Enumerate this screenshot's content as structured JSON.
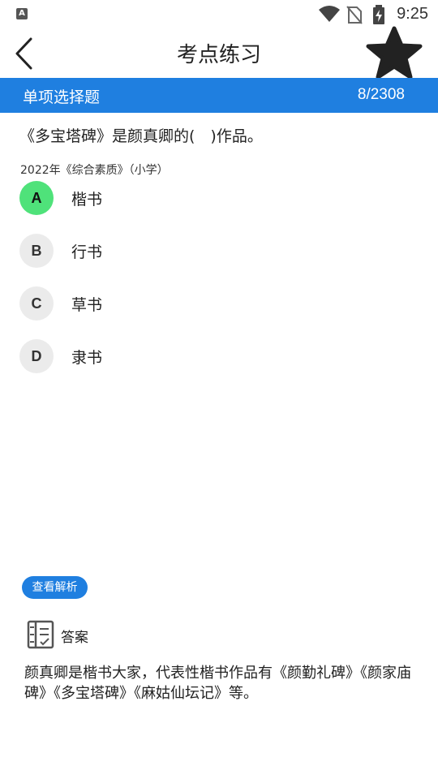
{
  "status_bar": {
    "app_icon": "A",
    "icons": [
      "wifi-icon",
      "no-sim-icon",
      "battery-charging-icon"
    ],
    "time": "9:25"
  },
  "header": {
    "title": "考点练习",
    "back_icon": "chevron-left-icon",
    "favorite_icon": "star-icon"
  },
  "section": {
    "title": "单项选择题",
    "progress": "8/2308"
  },
  "question": {
    "text": "《多宝塔碑》是颜真卿的(　)作品。",
    "source": "2022年《综合素质》（小学）",
    "options": [
      {
        "letter": "A",
        "text": "楷书",
        "selected": true
      },
      {
        "letter": "B",
        "text": "行书",
        "selected": false
      },
      {
        "letter": "C",
        "text": "草书",
        "selected": false
      },
      {
        "letter": "D",
        "text": "隶书",
        "selected": false
      }
    ]
  },
  "analysis": {
    "button_label": "查看解析",
    "answer_label": "答案",
    "answer_icon": "notebook-icon",
    "answer_text": "颜真卿是楷书大家，代表性楷书作品有《颜勤礼碑》《颜家庙碑》《多宝塔碑》《麻姑仙坛记》等。"
  },
  "colors": {
    "accent": "#1f7fe0",
    "selected": "#4fe27a",
    "option_bg": "#ebebeb"
  }
}
